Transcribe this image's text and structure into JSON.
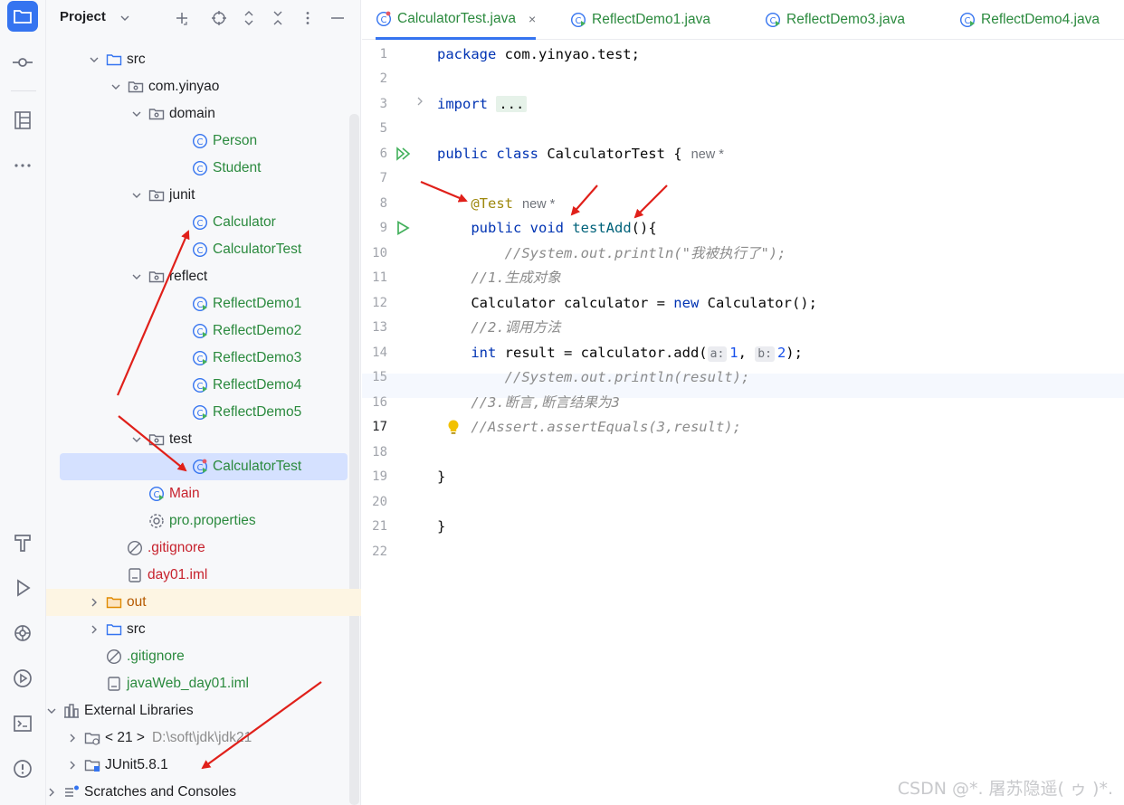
{
  "project_panel": {
    "title": "Project",
    "tree": [
      {
        "label": "src",
        "kind": "folder",
        "color": "#1e1f22"
      },
      {
        "label": "com.yinyao",
        "kind": "package",
        "color": "#1e1f22"
      },
      {
        "label": "domain",
        "kind": "package",
        "color": "#1e1f22"
      },
      {
        "label": "Person",
        "kind": "class",
        "color": "#2b8a3e"
      },
      {
        "label": "Student",
        "kind": "class",
        "color": "#2b8a3e"
      },
      {
        "label": "junit",
        "kind": "package",
        "color": "#1e1f22"
      },
      {
        "label": "Calculator",
        "kind": "class",
        "color": "#2b8a3e"
      },
      {
        "label": "CalculatorTest",
        "kind": "class",
        "color": "#2b8a3e"
      },
      {
        "label": "reflect",
        "kind": "package",
        "color": "#1e1f22"
      },
      {
        "label": "ReflectDemo1",
        "kind": "class-run",
        "color": "#2b8a3e"
      },
      {
        "label": "ReflectDemo2",
        "kind": "class-run",
        "color": "#2b8a3e"
      },
      {
        "label": "ReflectDemo3",
        "kind": "class-run",
        "color": "#2b8a3e"
      },
      {
        "label": "ReflectDemo4",
        "kind": "class-run",
        "color": "#2b8a3e"
      },
      {
        "label": "ReflectDemo5",
        "kind": "class-run",
        "color": "#2b8a3e"
      },
      {
        "label": "test",
        "kind": "package",
        "color": "#1e1f22"
      },
      {
        "label": "CalculatorTest",
        "kind": "class-test",
        "color": "#2b8a3e"
      },
      {
        "label": "Main",
        "kind": "class-run",
        "color": "#c7222d"
      },
      {
        "label": "pro.properties",
        "kind": "properties",
        "color": "#2b8a3e"
      },
      {
        "label": ".gitignore",
        "kind": "ignore",
        "color": "#c7222d"
      },
      {
        "label": "day01.iml",
        "kind": "iml",
        "color": "#c7222d"
      },
      {
        "label": "out",
        "kind": "folder-out",
        "color": "#b65a00"
      },
      {
        "label": "src",
        "kind": "folder",
        "color": "#1e1f22"
      },
      {
        "label": ".gitignore",
        "kind": "ignore",
        "color": "#2b8a3e"
      },
      {
        "label": "javaWeb_day01.iml",
        "kind": "iml",
        "color": "#2b8a3e"
      },
      {
        "label": "External Libraries",
        "kind": "libraries",
        "color": "#1e1f22"
      },
      {
        "label": "< 21 >",
        "sub": "D:\\soft\\jdk\\jdk21",
        "kind": "jdk",
        "color": "#1e1f22"
      },
      {
        "label": "JUnit5.8.1",
        "kind": "library",
        "color": "#1e1f22"
      },
      {
        "label": "Scratches and Consoles",
        "kind": "scratches",
        "color": "#1e1f22"
      }
    ]
  },
  "tabs": [
    {
      "label": "CalculatorTest.java",
      "active": true,
      "close": "×"
    },
    {
      "label": "ReflectDemo1.java",
      "active": false
    },
    {
      "label": "ReflectDemo3.java",
      "active": false
    },
    {
      "label": "ReflectDemo4.java",
      "active": false
    }
  ],
  "editor": {
    "line_numbers": [
      "1",
      "2",
      "3",
      "5",
      "6",
      "7",
      "8",
      "9",
      "10",
      "11",
      "12",
      "13",
      "14",
      "15",
      "16",
      "17",
      "18",
      "19",
      "20",
      "21",
      "22"
    ],
    "current_line": "17",
    "code": {
      "l1_kw": "package",
      "l1_rest": " com.yinyao.test;",
      "l3_kw": "import",
      "l3_fold": "...",
      "l6_kw": "public class",
      "l6_rest": " CalculatorTest {",
      "l6_hint": "new *",
      "l8_ann": "@Test",
      "l8_hint": "new *",
      "l9_kw": "public void",
      "l9_fn": "testAdd",
      "l9_rest": "(){",
      "l10_cm": "//System.out.println(\"我被执行了\");",
      "l11_cm": "//1.生成对象",
      "l12_a": "Calculator calculator = ",
      "l12_kw": "new",
      "l12_b": " Calculator();",
      "l13_cm": "//2.调用方法",
      "l14_kw": "int",
      "l14_a": " result = calculator.add(",
      "l14_pa": "a:",
      "l14_n1": "1",
      "l14_sep": ", ",
      "l14_pb": "b:",
      "l14_n2": "2",
      "l14_end": ");",
      "l15_cm": "//System.out.println(result);",
      "l16_cm": "//3.断言,断言结果为3",
      "l17_cm": "//Assert.assertEquals(3,result);",
      "l19": "}",
      "l21": "}"
    }
  },
  "watermark": "CSDN @*. 屠苏隐遥( ゥ )*.",
  "colors": {
    "accent": "#3574f0",
    "annotation_arrow": "#e0201a"
  }
}
